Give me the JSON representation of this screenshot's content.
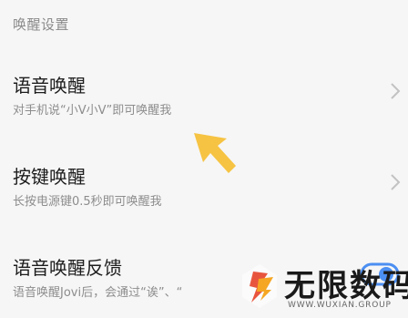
{
  "section_header": "唤醒设置",
  "rows": [
    {
      "title": "语音唤醒",
      "desc": "对手机说“小V小V”即可唤醒我"
    },
    {
      "title": "按键唤醒",
      "desc": "长按电源键0.5秒即可唤醒我"
    },
    {
      "title": "语音唤醒反馈",
      "desc": "语音唤醒Jovi后，会通过“诶”、“"
    }
  ],
  "watermark": {
    "title": "无限数码",
    "url": "WWW.WUXIAN.GROUP"
  },
  "colors": {
    "arrow": "#f6c343",
    "chevron": "#c2c2c2",
    "toggle": "#4c8ff2"
  },
  "icons": [
    "chevron-right-icon",
    "arrow-pointer-icon",
    "watermark-logo-icon"
  ]
}
